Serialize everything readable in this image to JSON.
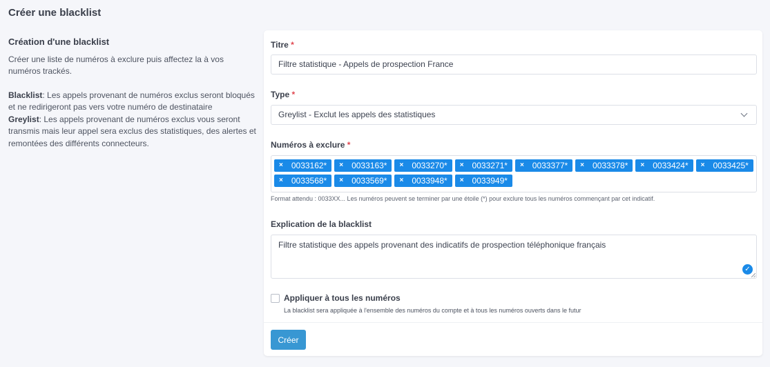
{
  "page": {
    "title": "Créer une blacklist"
  },
  "info": {
    "section_title": "Création d'une blacklist",
    "intro": "Créer une liste de numéros à exclure puis affectez la à vos numéros trackés.",
    "blacklist_term": "Blacklist",
    "blacklist_desc": ": Les appels provenant de numéros exclus seront bloqués et ne redirigeront pas vers votre numéro de destinataire",
    "greylist_term": "Greylist",
    "greylist_desc": ": Les appels provenant de numéros exclus vous seront transmis mais leur appel sera exclus des statistiques, des alertes et remontées des différents connecteurs."
  },
  "form": {
    "title_label": "Titre",
    "title_value": "Filtre statistique - Appels de prospection France",
    "type_label": "Type",
    "type_value": "Greylist - Exclut les appels des statistiques",
    "numbers_label": "Numéros à exclure",
    "numbers": [
      "0033162*",
      "0033163*",
      "0033270*",
      "0033271*",
      "0033377*",
      "0033378*",
      "0033424*",
      "0033425*",
      "0033568*",
      "0033569*",
      "0033948*",
      "0033949*"
    ],
    "numbers_hint": "Format attendu : 0033XX... Les numéros peuvent se terminer par une étoile (*) pour exclure tous les numéros commençant par cet indicatif.",
    "explanation_label": "Explication de la blacklist",
    "explanation_value": "Filtre statistique des appels provenant des indicatifs de prospection téléphonique français",
    "apply_all_label": "Appliquer à tous les numéros",
    "apply_all_help": "La blacklist sera appliquée à l'ensemble des numéros du compte et à tous les numéros ouverts dans le futur",
    "apply_all_checked": false,
    "required_mark": "*",
    "tag_remove_glyph": "×",
    "submit_label": "Créer"
  },
  "colors": {
    "tag_bg": "#1a8ae8",
    "button_bg": "#3897d3",
    "required": "#e0464f"
  }
}
